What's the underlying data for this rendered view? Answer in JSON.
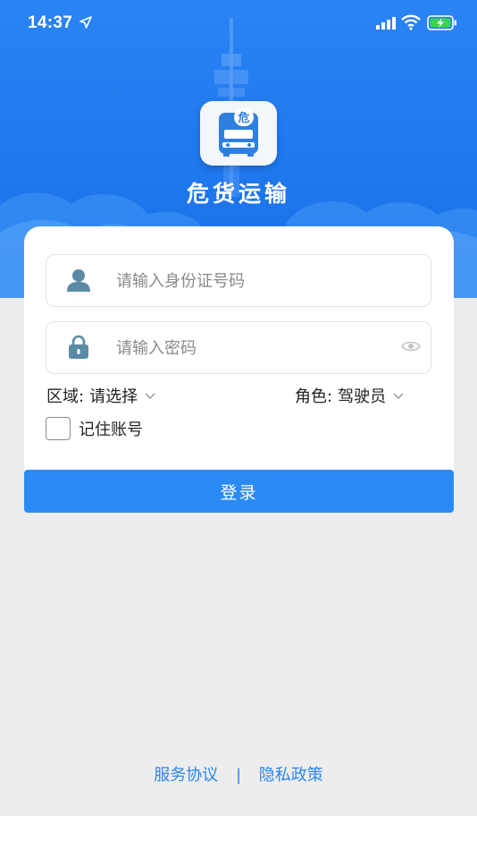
{
  "status_bar": {
    "time": "14:37"
  },
  "app": {
    "name": "危货运输",
    "logo_badge": "危"
  },
  "login_form": {
    "id_placeholder": "请输入身份证号码",
    "password_placeholder": "请输入密码",
    "region": {
      "label": "区域:",
      "value": "请选择"
    },
    "role": {
      "label": "角色:",
      "value": "驾驶员"
    },
    "remember_label": "记住账号",
    "remember_checked": false,
    "login_button": "登录"
  },
  "footer": {
    "service_agreement": "服务协议",
    "separator": "|",
    "privacy_policy": "隐私政策"
  },
  "colors": {
    "primary": "#2b8bf4",
    "hero_blue": "#1f78ee",
    "background": "#ededed"
  },
  "icons": {
    "location": "location-arrow-icon",
    "signal": "cellular-signal-icon",
    "wifi": "wifi-icon",
    "battery": "battery-charging-icon",
    "user": "user-icon",
    "lock": "lock-icon",
    "eye": "eye-icon",
    "chevron": "chevron-down-icon"
  }
}
